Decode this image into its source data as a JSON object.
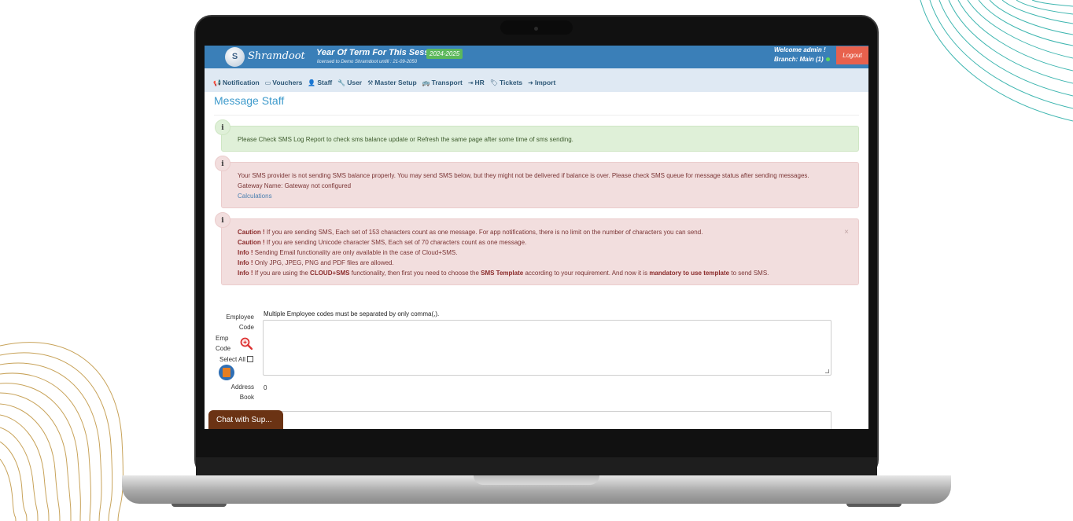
{
  "header": {
    "logo_mark": "S",
    "logo_text": "Shramdoot",
    "session_title": "Year Of Term For This Session :-",
    "session_badge": "2024-2025",
    "licensed": "licensed to Demo Shramdoot untill : 21-09-2050",
    "welcome": "Welcome admin !",
    "branch": "Branch: Main (1)",
    "logout": "Logout"
  },
  "menu": [
    {
      "label": "Notification",
      "icon": "bullhorn-icon"
    },
    {
      "label": "Vouchers",
      "icon": "money-icon"
    },
    {
      "label": "Staff",
      "icon": "user-icon"
    },
    {
      "label": "User",
      "icon": "wrench-icon"
    },
    {
      "label": "Master Setup",
      "icon": "gavel-icon"
    },
    {
      "label": "Transport",
      "icon": "bus-icon"
    },
    {
      "label": "HR",
      "icon": "sign-in-icon"
    },
    {
      "label": "Tickets",
      "icon": "tag-icon"
    },
    {
      "label": "Import",
      "icon": "arrow-right-icon"
    }
  ],
  "page_title": "Message Staff",
  "alerts": {
    "success_text": "Please Check SMS Log Report to check sms balance update or Refresh the same page after some time of sms sending.",
    "danger1": {
      "line1": "Your SMS provider is not sending SMS balance properly. You may send SMS below, but they might not be delivered if balance is over. Please check SMS queue for message status after sending messages.",
      "line2": "Gateway Name: Gateway not configured",
      "link": "Calculations"
    },
    "danger2": {
      "caution": "Caution !",
      "info": "Info !",
      "l1": " If you are sending SMS, Each set of 153 characters count as one message. For app notifications, there is no limit on the number of characters you can send.",
      "l2": " If you are sending Unicode character SMS, Each set of 70 characters count as one message.",
      "l3": " Sending Email functionality are only available in the case of Cloud+SMS.",
      "l4": " Only JPG, JPEG, PNG and PDF files are allowed.",
      "l5a": " If you are using the ",
      "l5b": "CLOUD+SMS",
      "l5c": " functionality, then first you need to choose the ",
      "l5d": "SMS Template",
      "l5e": " according to your requirement. And now it is ",
      "l5f": "mandatory to use template",
      "l5g": " to send SMS.",
      "close": "×"
    },
    "info_glyph": "i"
  },
  "form": {
    "employee_code_label1": "Employee",
    "employee_code_label2": "Code",
    "emp_code_label1": "Emp",
    "emp_code_label2": "Code",
    "select_all": "Select All",
    "address_book1": "Address",
    "address_book2": "Book",
    "hint": "Multiple Employee codes must be separated by only comma(,).",
    "count": "0"
  },
  "chat": "Chat with Sup..."
}
